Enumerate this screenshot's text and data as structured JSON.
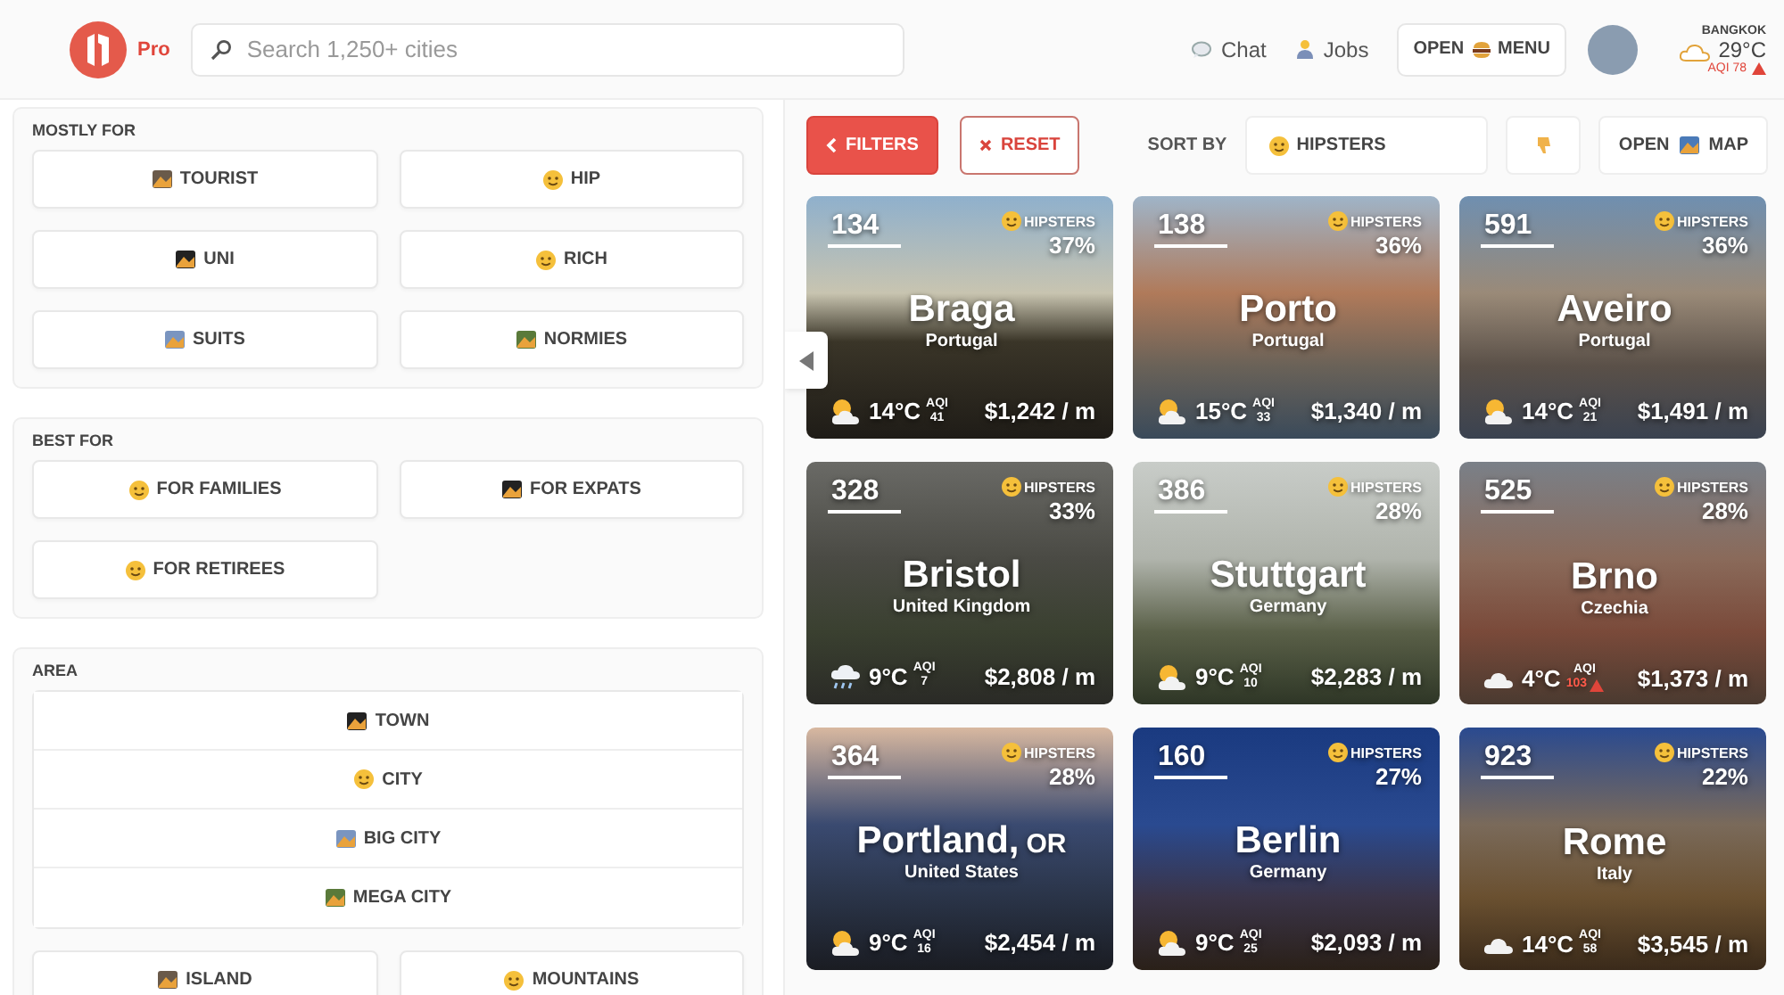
{
  "header": {
    "logo_badge": "Pro",
    "search": {
      "placeholder": "Search 1,250+ cities"
    },
    "links": [
      "Chat",
      "Jobs"
    ],
    "menu_button": [
      "OPEN",
      "MENU"
    ],
    "location": {
      "city": "BANGKOK",
      "temperature": "29°C",
      "aqi": "AQI 78",
      "aqi_alert": true
    }
  },
  "filters": {
    "sections": [
      {
        "title": "MOSTLY FOR",
        "options": [
          {
            "label": "TOURIST",
            "kind": "tile"
          },
          {
            "label": "HIP",
            "kind": "tile"
          },
          {
            "label": "UNI",
            "kind": "tile"
          },
          {
            "label": "RICH",
            "kind": "tile"
          },
          {
            "label": "SUITS",
            "kind": "tile"
          },
          {
            "label": "NORMIES",
            "kind": "tile"
          }
        ]
      },
      {
        "title": "BEST FOR",
        "options": [
          {
            "label": "FOR FAMILIES",
            "kind": "tile"
          },
          {
            "label": "FOR EXPATS",
            "kind": "tile"
          },
          {
            "label": "FOR RETIREES",
            "kind": "tile"
          }
        ]
      },
      {
        "title": "AREA",
        "options": [
          {
            "label": "TOWN",
            "kind": "stacked"
          },
          {
            "label": "CITY",
            "kind": "stacked"
          },
          {
            "label": "BIG CITY",
            "kind": "stacked"
          },
          {
            "label": "MEGA CITY",
            "kind": "stacked"
          },
          {
            "label": "ISLAND",
            "kind": "tile"
          },
          {
            "label": "MOUNTAINS",
            "kind": "tile"
          }
        ]
      }
    ]
  },
  "toolbar": {
    "filters_button": "FILTERS",
    "reset_button": "RESET",
    "sort_label": "SORT BY",
    "sort_value": "HIPSTERS",
    "map_button": [
      "OPEN",
      "MAP"
    ]
  },
  "cards": [
    {
      "rank": "134",
      "city": "Braga",
      "country": "Portugal",
      "metric": "HIPSTERS",
      "share": "37%",
      "weather": {
        "kind": "sun-cloud"
      },
      "temperature": "14°C",
      "aqi_label": "AQI",
      "aqi": "41",
      "aqi_alert": false,
      "price": "$1,242 / m"
    },
    {
      "rank": "138",
      "city": "Porto",
      "country": "Portugal",
      "metric": "HIPSTERS",
      "share": "36%",
      "weather": {
        "kind": "sun-cloud"
      },
      "temperature": "15°C",
      "aqi_label": "AQI",
      "aqi": "33",
      "aqi_alert": false,
      "price": "$1,340 / m"
    },
    {
      "rank": "591",
      "city": "Aveiro",
      "country": "Portugal",
      "metric": "HIPSTERS",
      "share": "36%",
      "weather": {
        "kind": "sun-cloud"
      },
      "temperature": "14°C",
      "aqi_label": "AQI",
      "aqi": "21",
      "aqi_alert": false,
      "price": "$1,491 / m"
    },
    {
      "rank": "328",
      "city": "Bristol",
      "country": "United Kingdom",
      "metric": "HIPSTERS",
      "share": "33%",
      "weather": {
        "kind": "rain"
      },
      "temperature": "9°C",
      "aqi_label": "AQI",
      "aqi": "7",
      "aqi_alert": false,
      "price": "$2,808 / m"
    },
    {
      "rank": "386",
      "city": "Stuttgart",
      "country": "Germany",
      "metric": "HIPSTERS",
      "share": "28%",
      "weather": {
        "kind": "sun-cloud"
      },
      "temperature": "9°C",
      "aqi_label": "AQI",
      "aqi": "10",
      "aqi_alert": false,
      "price": "$2,283 / m"
    },
    {
      "rank": "525",
      "city": "Brno",
      "country": "Czechia",
      "metric": "HIPSTERS",
      "share": "28%",
      "weather": {
        "kind": "cloud"
      },
      "temperature": "4°C",
      "aqi_label": "AQI",
      "aqi": "103",
      "aqi_alert": true,
      "price": "$1,373 / m"
    },
    {
      "rank": "364",
      "city": "Portland,",
      "region": "OR",
      "country": "United States",
      "metric": "HIPSTERS",
      "share": "28%",
      "weather": {
        "kind": "sun-cloud"
      },
      "temperature": "9°C",
      "aqi_label": "AQI",
      "aqi": "16",
      "aqi_alert": false,
      "price": "$2,454 / m"
    },
    {
      "rank": "160",
      "city": "Berlin",
      "country": "Germany",
      "metric": "HIPSTERS",
      "share": "27%",
      "weather": {
        "kind": "sun-cloud"
      },
      "temperature": "9°C",
      "aqi_label": "AQI",
      "aqi": "25",
      "aqi_alert": false,
      "price": "$2,093 / m"
    },
    {
      "rank": "923",
      "city": "Rome",
      "country": "Italy",
      "metric": "HIPSTERS",
      "share": "22%",
      "weather": {
        "kind": "cloud"
      },
      "temperature": "14°C",
      "aqi_label": "AQI",
      "aqi": "58",
      "aqi_alert": false,
      "price": "$3,545 / m"
    }
  ]
}
